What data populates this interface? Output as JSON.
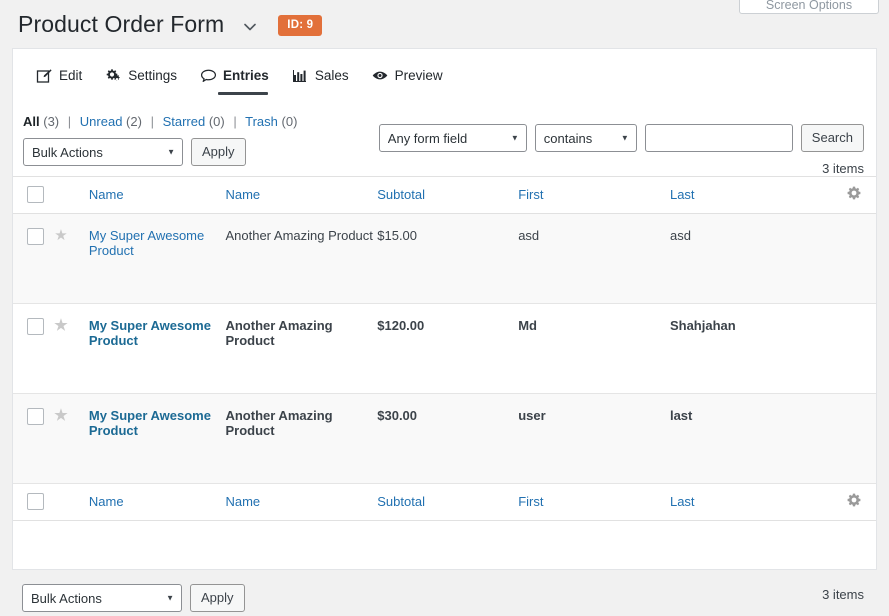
{
  "screen_options": {
    "label": "Screen Options"
  },
  "header": {
    "title": "Product Order Form",
    "caret_icon": "chevron-down-icon",
    "id_badge": "ID: 9"
  },
  "tabs": [
    {
      "label": "Edit",
      "icon": "edit-pencil-icon",
      "active": false
    },
    {
      "label": "Settings",
      "icon": "gears-icon",
      "active": false
    },
    {
      "label": "Entries",
      "icon": "comment-icon",
      "active": true
    },
    {
      "label": "Sales",
      "icon": "bar-chart-icon",
      "active": false
    },
    {
      "label": "Preview",
      "icon": "eye-icon",
      "active": false
    }
  ],
  "filters": [
    {
      "label": "All",
      "count": "(3)",
      "current": true
    },
    {
      "label": "Unread",
      "count": "(2)",
      "current": false
    },
    {
      "label": "Starred",
      "count": "(0)",
      "current": false
    },
    {
      "label": "Trash",
      "count": "(0)",
      "current": false
    }
  ],
  "separator": "|",
  "search": {
    "field_value": "Any form field",
    "operator_value": "contains",
    "input_value": "",
    "input_placeholder": "",
    "button_label": "Search"
  },
  "toolbar": {
    "bulk_value": "Bulk Actions",
    "apply_label": "Apply",
    "items_count": "3 items"
  },
  "table": {
    "columns": [
      "Name",
      "Name",
      "Subtotal",
      "First",
      "Last"
    ],
    "gear_icon": "gear-icon",
    "star_icon": "star-icon",
    "checkbox_icon": "checkbox-icon",
    "rows": [
      {
        "unread": false,
        "product": "My Super Awesome Product",
        "product2": "Another Amazing Product",
        "subtotal": "$15.00",
        "first": "asd",
        "last": "asd"
      },
      {
        "unread": true,
        "product": "My Super Awesome Product",
        "product2": "Another Amazing Product",
        "subtotal": "$120.00",
        "first": "Md",
        "last": "Shahjahan"
      },
      {
        "unread": true,
        "product": "My Super Awesome Product",
        "product2": "Another Amazing Product",
        "subtotal": "$30.00",
        "first": "user",
        "last": "last"
      }
    ]
  },
  "colors": {
    "link": "#2271b1",
    "badge_orange": "#e2703a",
    "row_stripe": "#f9f9f9",
    "page_bg": "#f1f1f1"
  }
}
